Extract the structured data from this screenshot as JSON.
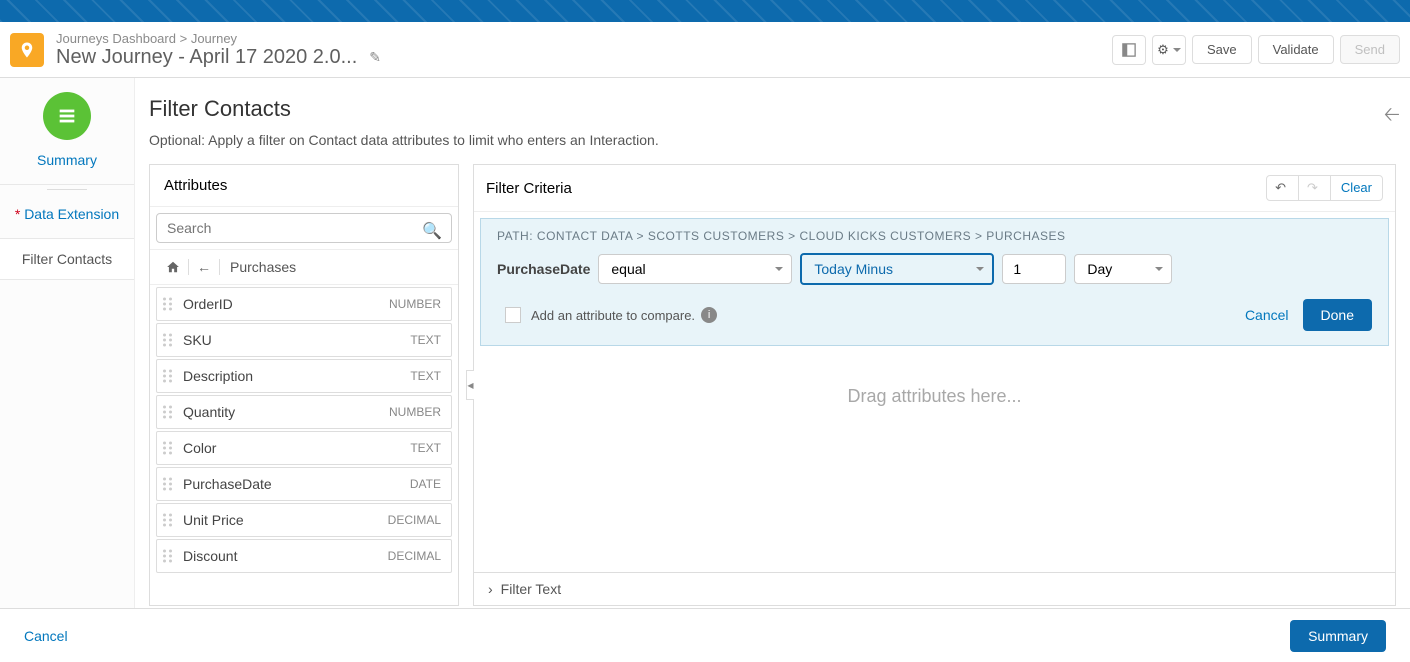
{
  "header": {
    "breadcrumb_root": "Journeys Dashboard",
    "breadcrumb_sep": ">",
    "breadcrumb_leaf": "Journey",
    "title": "New Journey - April 17 2020 2.0...",
    "save_label": "Save",
    "validate_label": "Validate",
    "send_label": "Send"
  },
  "left_nav": {
    "summary": "Summary",
    "data_ext_prefix": "*",
    "data_ext": "Data Extension",
    "filter_contacts": "Filter Contacts"
  },
  "content": {
    "heading": "Filter Contacts",
    "subtitle": "Optional: Apply a filter on Contact data attributes to limit who enters an Interaction."
  },
  "attributes_panel": {
    "header": "Attributes",
    "search_placeholder": "Search",
    "location": "Purchases",
    "items": [
      {
        "name": "OrderID",
        "type": "NUMBER"
      },
      {
        "name": "SKU",
        "type": "TEXT"
      },
      {
        "name": "Description",
        "type": "TEXT"
      },
      {
        "name": "Quantity",
        "type": "NUMBER"
      },
      {
        "name": "Color",
        "type": "TEXT"
      },
      {
        "name": "PurchaseDate",
        "type": "DATE"
      },
      {
        "name": "Unit Price",
        "type": "DECIMAL"
      },
      {
        "name": "Discount",
        "type": "DECIMAL"
      }
    ]
  },
  "criteria_panel": {
    "header": "Filter Criteria",
    "clear_label": "Clear",
    "path_prefix": "PATH:",
    "path": [
      "CONTACT DATA",
      "SCOTTS CUSTOMERS",
      "CLOUD KICKS CUSTOMERS",
      "PURCHASES"
    ],
    "field_name": "PurchaseDate",
    "operator": "equal",
    "relative": "Today Minus",
    "number_value": "1",
    "unit": "Day",
    "compare_label": "Add an attribute to compare.",
    "cancel_label": "Cancel",
    "done_label": "Done",
    "drag_hint": "Drag attributes here...",
    "filter_text_label": "Filter Text"
  },
  "footer": {
    "cancel_label": "Cancel",
    "summary_label": "Summary"
  }
}
